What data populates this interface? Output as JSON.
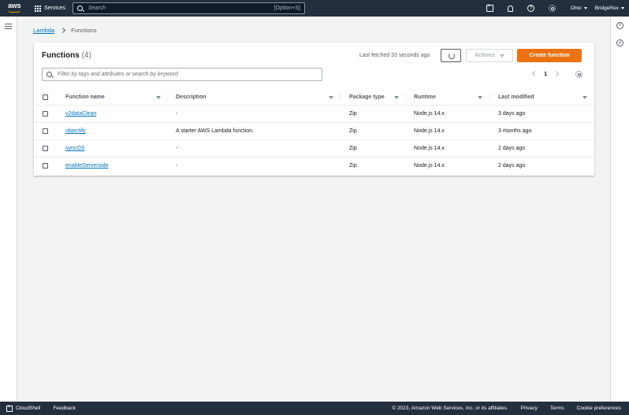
{
  "topnav": {
    "logo": "aws",
    "services_label": "Services",
    "search_placeholder": "Search",
    "search_shortcut": "[Option+S]",
    "region": "Ohio",
    "account": "BridgeRev"
  },
  "breadcrumb": {
    "root": "Lambda",
    "current": "Functions"
  },
  "panel": {
    "title": "Functions",
    "count": "(4)",
    "last_fetched": "Last fetched 33 seconds ago",
    "actions_label": "Actions",
    "create_label": "Create function",
    "filter_placeholder": "Filter by tags and attributes or search by keyword",
    "page_number": "1"
  },
  "table": {
    "headers": {
      "name": "Function name",
      "description": "Description",
      "package": "Package type",
      "runtime": "Runtime",
      "modified": "Last modified"
    },
    "rows": [
      {
        "name": "v2dataClean",
        "description": "-",
        "package": "Zip",
        "runtime": "Node.js 14.x",
        "modified": "3 days ago"
      },
      {
        "name": "objectify",
        "description": "A starter AWS Lambda function.",
        "package": "Zip",
        "runtime": "Node.js 14.x",
        "modified": "3 months ago"
      },
      {
        "name": "syncOS",
        "description": "-",
        "package": "Zip",
        "runtime": "Node.js 14.x",
        "modified": "2 days ago"
      },
      {
        "name": "enableServerside",
        "description": "-",
        "package": "Zip",
        "runtime": "Node.js 14.x",
        "modified": "2 days ago"
      }
    ]
  },
  "footer": {
    "cloudshell": "CloudShell",
    "feedback": "Feedback",
    "copyright": "© 2023, Amazon Web Services, Inc. or its affiliates.",
    "privacy": "Privacy",
    "terms": "Terms",
    "cookies": "Cookie preferences"
  },
  "colors": {
    "nav_bg": "#232f3e",
    "primary_button": "#ec7211",
    "link": "#0073bb"
  }
}
